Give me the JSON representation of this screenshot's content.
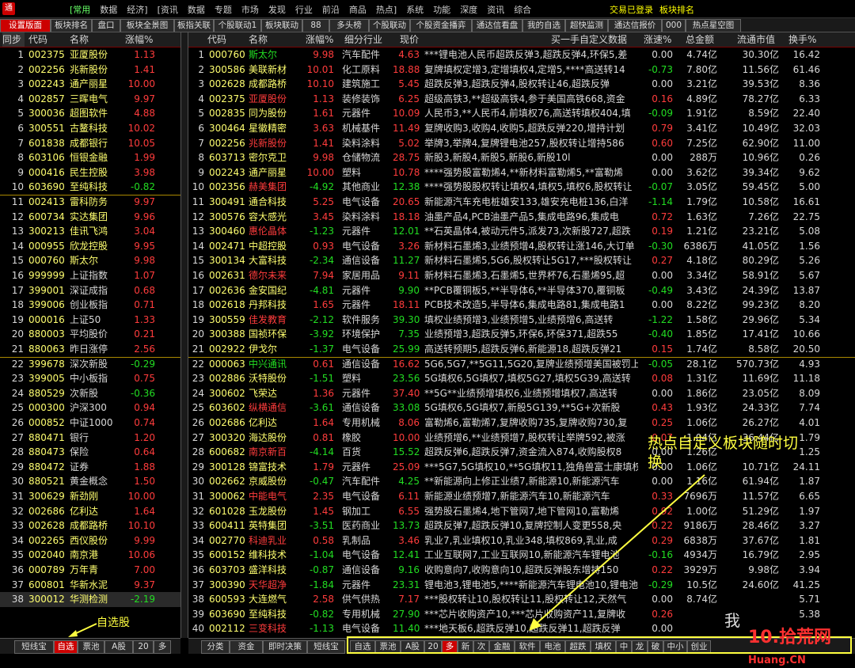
{
  "menubar": {
    "items": [
      "[常用",
      "数据",
      "经济]",
      "[资讯",
      "数据",
      "专题",
      "市场",
      "发现",
      "行业",
      "前沿",
      "商品",
      "热点]",
      "系统",
      "功能",
      "深度",
      "资讯",
      "综合"
    ],
    "login_status": "交易已登录",
    "block_rank": "板块排名"
  },
  "tabs": [
    "设置版面",
    "板块排名",
    "盘口",
    "板块全景图",
    "板指关联",
    "个股联动1",
    "板块联动",
    "88",
    "多头榜",
    "个股联动",
    "个股资金播弈",
    "通达信看盘",
    "我的自选",
    "超快监测",
    "通达信报价",
    "000",
    "热点星空图"
  ],
  "left_panel": {
    "headers": [
      "同步",
      "代码",
      "名称",
      "涨幅%"
    ],
    "rows": [
      [
        "1",
        "002375",
        "亚厦股份",
        "1.13"
      ],
      [
        "2",
        "002256",
        "兆新股份",
        "1.41"
      ],
      [
        "3",
        "002243",
        "通产丽星",
        "10.00"
      ],
      [
        "4",
        "002857",
        "三晖电气",
        "9.97"
      ],
      [
        "5",
        "300036",
        "超图软件",
        "4.88"
      ],
      [
        "6",
        "300551",
        "古鳌科技",
        "10.02"
      ],
      [
        "7",
        "601838",
        "成都银行",
        "10.05"
      ],
      [
        "8",
        "603106",
        "恒银金融",
        "1.99"
      ],
      [
        "9",
        "000416",
        "民生控股",
        "3.98"
      ],
      [
        "10",
        "603690",
        "至纯科技",
        "-0.82"
      ],
      [
        "11",
        "002413",
        "雷科防务",
        "9.97"
      ],
      [
        "12",
        "600734",
        "实达集团",
        "9.96"
      ],
      [
        "13",
        "300213",
        "佳讯飞鸿",
        "3.04"
      ],
      [
        "14",
        "000955",
        "欣龙控股",
        "9.95"
      ],
      [
        "15",
        "000760",
        "斯太尔",
        "9.98"
      ],
      [
        "16",
        "999999",
        "上证指数",
        "1.07"
      ],
      [
        "17",
        "399001",
        "深证成指",
        "0.68"
      ],
      [
        "18",
        "399006",
        "创业板指",
        "0.71"
      ],
      [
        "19",
        "000016",
        "上证50",
        "1.33"
      ],
      [
        "20",
        "880003",
        "平均股价",
        "0.21"
      ],
      [
        "21",
        "880063",
        "昨日涨停",
        "2.56"
      ],
      [
        "22",
        "399678",
        "深次新股",
        "-0.29"
      ],
      [
        "23",
        "399005",
        "中小板指",
        "0.75"
      ],
      [
        "24",
        "880529",
        "次新股",
        "-0.36"
      ],
      [
        "25",
        "000300",
        "沪深300",
        "0.94"
      ],
      [
        "26",
        "000852",
        "中证1000",
        "0.74"
      ],
      [
        "27",
        "880471",
        "银行",
        "1.20"
      ],
      [
        "28",
        "880473",
        "保险",
        "0.64"
      ],
      [
        "29",
        "880472",
        "证券",
        "1.88"
      ],
      [
        "30",
        "880521",
        "黄金概念",
        "1.50"
      ],
      [
        "31",
        "300629",
        "新劲刚",
        "10.00"
      ],
      [
        "32",
        "002686",
        "亿利达",
        "1.64"
      ],
      [
        "33",
        "002628",
        "成都路桥",
        "10.10"
      ],
      [
        "34",
        "002265",
        "西仪股份",
        "9.99"
      ],
      [
        "35",
        "002040",
        "南京港",
        "10.06"
      ],
      [
        "36",
        "000789",
        "万年青",
        "7.00"
      ],
      [
        "37",
        "600801",
        "华新水泥",
        "9.37"
      ],
      [
        "38",
        "300012",
        "华测检测",
        "-2.19"
      ]
    ]
  },
  "right_panel": {
    "headers": [
      "代码",
      "名称",
      "涨幅%",
      "细分行业",
      "现价",
      "买一手自定义数据",
      "涨速%",
      "总金额",
      "流通市值",
      "换手%"
    ],
    "rows": [
      [
        "1",
        "000760",
        "斯太尔",
        "9.98",
        "汽车配件",
        "4.63",
        "***锂电池人民币超跌反弹3,超跌反弹4,环保5,差",
        "0.00",
        "4.74亿",
        "30.30亿",
        "16.42"
      ],
      [
        "2",
        "300586",
        "美联新材",
        "10.01",
        "化工原料",
        "18.88",
        "复牌填权定增3,定增填权4,定增5,****高送转14",
        "-0.73",
        "7.80亿",
        "11.56亿",
        "61.46"
      ],
      [
        "3",
        "002628",
        "成都路桥",
        "10.10",
        "建筑施工",
        "5.45",
        "超跌反弹3,超跌反弹4,股权转让46,超跌反弹",
        "0.00",
        "3.21亿",
        "39.53亿",
        "8.36"
      ],
      [
        "4",
        "002375",
        "亚厦股份",
        "1.13",
        "装修装饰",
        "6.25",
        "超级高铁3,**超级高铁4,参于美国高铁668,资金",
        "0.16",
        "4.89亿",
        "78.27亿",
        "6.33"
      ],
      [
        "5",
        "002835",
        "同为股份",
        "1.61",
        "元器件",
        "10.09",
        "人民币3,**人民币4,前填权76,高送转填权404,填",
        "-0.09",
        "1.91亿",
        "8.59亿",
        "22.40"
      ],
      [
        "6",
        "300464",
        "星徽精密",
        "3.63",
        "机械基件",
        "11.49",
        "复牌收购3,收购4,收购5,超跌反弹220,增持计划",
        "0.79",
        "3.41亿",
        "10.49亿",
        "32.03"
      ],
      [
        "7",
        "002256",
        "兆新股份",
        "1.41",
        "染料涂料",
        "5.02",
        "举牌3,举牌4,复牌锂电池257,股权转让增持586",
        "0.60",
        "7.25亿",
        "62.90亿",
        "11.00"
      ],
      [
        "8",
        "603713",
        "密尔克卫",
        "9.98",
        "仓储物流",
        "28.75",
        "新股3,新股4,新股5,新股6,新股10l",
        "0.00",
        "288万",
        "10.96亿",
        "0.26"
      ],
      [
        "9",
        "002243",
        "通产丽星",
        "10.00",
        "塑料",
        "10.78",
        "****强势股富勒烯4,**新材料富勒烯5,**富勒烯",
        "0.00",
        "3.62亿",
        "39.34亿",
        "9.62"
      ],
      [
        "10",
        "002356",
        "赫美集团",
        "-4.92",
        "其他商业",
        "12.38",
        "****强势股股权转让填权4,填权5,填权6,股权转让",
        "-0.07",
        "3.05亿",
        "59.45亿",
        "5.00"
      ],
      [
        "11",
        "300491",
        "通合科技",
        "5.25",
        "电气设备",
        "20.65",
        "新能源汽车充电桩雄安133,雄安充电桩136,白洋",
        "-1.14",
        "1.79亿",
        "10.58亿",
        "16.61"
      ],
      [
        "12",
        "300576",
        "容大感光",
        "3.45",
        "染料涂料",
        "18.18",
        "油墨产品4,PCB油墨产品5,集成电路96,集成电",
        "0.72",
        "1.63亿",
        "7.26亿",
        "22.75"
      ],
      [
        "13",
        "300460",
        "惠伦晶体",
        "-1.23",
        "元器件",
        "12.01",
        "**石英晶体4,被动元件5,派发73,次新股727,超跌",
        "0.19",
        "1.21亿",
        "23.21亿",
        "5.08"
      ],
      [
        "14",
        "002471",
        "中超控股",
        "0.93",
        "电气设备",
        "3.26",
        "新材料石墨烯3,业绩预增4,股权转让涨146,大订单",
        "-0.30",
        "6386万",
        "41.05亿",
        "1.56"
      ],
      [
        "15",
        "300134",
        "大富科技",
        "-2.34",
        "通信设备",
        "11.27",
        "新材料石墨烯5,5G6,股权转让5G17,***股权转让",
        "0.27",
        "4.18亿",
        "80.29亿",
        "5.26"
      ],
      [
        "16",
        "002631",
        "德尔未来",
        "7.94",
        "家居用品",
        "9.11",
        "新材料石墨烯3,石墨烯5,世界杯76,石墨烯95,超",
        "0.00",
        "3.34亿",
        "58.91亿",
        "5.67"
      ],
      [
        "17",
        "002636",
        "金安国纪",
        "-4.81",
        "元器件",
        "9.90",
        "**PCB覆铜板5,**半导体6,**半导体370,覆铜板",
        "-0.49",
        "3.43亿",
        "24.39亿",
        "13.87"
      ],
      [
        "18",
        "002618",
        "丹邦科技",
        "1.65",
        "元器件",
        "18.11",
        "PCB技术改造5,半导体6,集成电路81,集成电路1",
        "0.00",
        "8.22亿",
        "99.23亿",
        "8.20"
      ],
      [
        "19",
        "300559",
        "佳发教育",
        "-2.12",
        "软件服务",
        "39.30",
        "填权业绩预增3,业绩预增5,业绩预增6,高送转",
        "-1.22",
        "1.58亿",
        "29.96亿",
        "5.34"
      ],
      [
        "20",
        "300388",
        "国祯环保",
        "-3.92",
        "环境保护",
        "7.35",
        "业绩预增3,超跌反弹5,环保6,环保371,超跌55",
        "-0.40",
        "1.85亿",
        "17.41亿",
        "10.66"
      ],
      [
        "21",
        "002922",
        "伊戈尔",
        "-1.37",
        "电气设备",
        "25.99",
        "高送转预期5,超跌反弹6,新能源18,超跌反弹21",
        "0.15",
        "1.74亿",
        "8.58亿",
        "20.50"
      ],
      [
        "22",
        "000063",
        "中兴通讯",
        "0.61",
        "通信设备",
        "16.62",
        "5G6,5G7,**5G11,5G20,复牌业绩预增美国被罚上",
        "-0.05",
        "28.1亿",
        "570.73亿",
        "4.93"
      ],
      [
        "23",
        "002886",
        "沃特股份",
        "-1.51",
        "塑料",
        "23.56",
        "5G填权6,5G填权7,填权5G27,填权5G39,高送转",
        "0.08",
        "1.31亿",
        "11.69亿",
        "11.18"
      ],
      [
        "24",
        "300602",
        "飞荣达",
        "1.36",
        "元器件",
        "37.40",
        "**5G**业绩预增填权6,业绩预增填权7,高送转",
        "0.00",
        "1.86亿",
        "23.05亿",
        "8.09"
      ],
      [
        "25",
        "603602",
        "纵横通信",
        "-3.61",
        "通信设备",
        "33.08",
        "5G填权6,5G填权7,新股5G139,**5G+次新股",
        "0.43",
        "1.93亿",
        "24.33亿",
        "7.74"
      ],
      [
        "26",
        "002686",
        "亿利达",
        "1.64",
        "专用机械",
        "8.06",
        "富勒烯6,富勒烯7,复牌收购735,复牌收购730,复",
        "0.25",
        "1.06亿",
        "26.27亿",
        "4.01"
      ],
      [
        "27",
        "300320",
        "海达股份",
        "0.81",
        "橡胶",
        "10.00",
        "业绩预增6,**业绩预增7,股权转让举牌592,被涨",
        "0.07",
        "1.04亿",
        "36.44亿",
        "1.79"
      ],
      [
        "28",
        "600682",
        "南京新百",
        "-4.14",
        "百货",
        "15.52",
        "超跌反弹6,超跌反弹7,资金流入874,收购股权8",
        "0.00",
        "1.26亿",
        "",
        "1.25"
      ],
      [
        "29",
        "300128",
        "锦富技术",
        "1.79",
        "元器件",
        "25.09",
        "***5G7,5G填权10,**5G填权11,独角兽富士康填权",
        "0.00",
        "1.06亿",
        "10.71亿",
        "24.11"
      ],
      [
        "30",
        "002662",
        "京威股份",
        "-0.47",
        "汽车配件",
        "4.25",
        "**新能源向上修正业绩7,新能源10,新能源汽车",
        "0.00",
        "1.16亿",
        "61.94亿",
        "1.87"
      ],
      [
        "31",
        "300062",
        "中能电气",
        "2.35",
        "电气设备",
        "6.11",
        "新能源业绩预增7,新能源汽车10,新能源汽车",
        "0.33",
        "7696万",
        "11.57亿",
        "6.65"
      ],
      [
        "32",
        "601028",
        "玉龙股份",
        "1.45",
        "钢加工",
        "6.55",
        "强势股石墨烯4,地下管网7,地下管网10,富勒烯",
        "0.92",
        "1.00亿",
        "51.29亿",
        "1.97"
      ],
      [
        "33",
        "600411",
        "英特集团",
        "-3.51",
        "医药商业",
        "13.73",
        "超跌反弹7,超跌反弹10,复牌控制人变更558,央",
        "0.22",
        "9186万",
        "28.46亿",
        "3.27"
      ],
      [
        "34",
        "002770",
        "科迪乳业",
        "0.58",
        "乳制品",
        "3.46",
        "乳业7,乳业填权10,乳业348,填权869,乳业,成",
        "0.29",
        "6838万",
        "37.67亿",
        "1.81"
      ],
      [
        "35",
        "600152",
        "维科技术",
        "-1.04",
        "电气设备",
        "12.41",
        "工业互联网7,工业互联网10,新能源汽车锂电池",
        "-0.16",
        "4934万",
        "16.79亿",
        "2.95"
      ],
      [
        "36",
        "603703",
        "盛洋科技",
        "-0.87",
        "通信设备",
        "9.16",
        "收购意向7,收购意向10,超跌反弹股东增持150",
        "0.22",
        "3929万",
        "9.98亿",
        "3.94"
      ],
      [
        "37",
        "300390",
        "天华超净",
        "-1.84",
        "元器件",
        "23.31",
        "锂电池3,锂电池5,****新能源汽车锂电池10,锂电池",
        "-0.29",
        "10.5亿",
        "24.60亿",
        "41.25"
      ],
      [
        "38",
        "600593",
        "大连燃气",
        "2.58",
        "供气供热",
        "7.17",
        "***股权转让10,股权转让11,股权转让12,天然气",
        "0.00",
        "8.74亿",
        "",
        "5.71"
      ],
      [
        "39",
        "603690",
        "至纯科技",
        "-0.82",
        "专用机械",
        "27.90",
        "***芯片收购资产10,***芯片收购资产11,复牌收",
        "0.26",
        "",
        "",
        "5.38"
      ],
      [
        "40",
        "002112",
        "三变科技",
        "-1.13",
        "电气设备",
        "11.40",
        "***地天板6,超跌反弹10,超跌反弹11,超跌反弹",
        "0.00",
        "",
        "",
        ""
      ]
    ]
  },
  "bottom_left_tabs": [
    "短线宝",
    "自选",
    "票池",
    "A股",
    "20",
    "多"
  ],
  "bottom_mid_tabs": [
    "分类",
    "资金",
    "即时决策",
    "短线宝"
  ],
  "bottom_right_tabs": [
    "自选",
    "票池",
    "A股",
    "20",
    "多",
    "新",
    "次",
    "金融",
    "软件",
    "电池",
    "超跌",
    "填权",
    "中",
    "龙",
    "破",
    "中小",
    "创业"
  ],
  "annotations": {
    "zixuan_label": "自选股",
    "hotspot_label": "热点自定义板块随时切换"
  },
  "watermark": {
    "line1": "我",
    "brand": "10.拾荒网",
    "site": "Huang.CN"
  },
  "colors": {
    "up": "#ff3c3c",
    "down": "#22dd22",
    "accent": "#cc0000",
    "highlight": "#ffff40"
  }
}
